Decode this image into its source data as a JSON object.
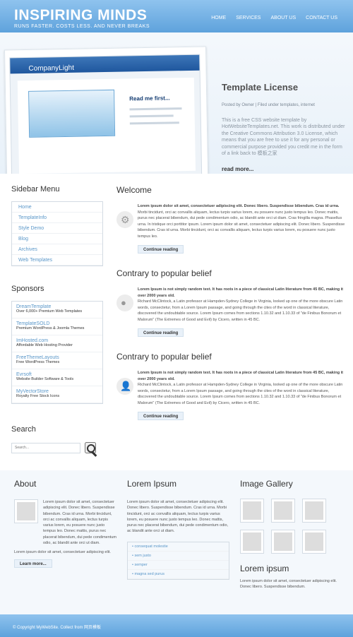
{
  "brand": {
    "title": "INSPIRING MINDS",
    "tagline": "RUNS FASTER. COSTS LESS. AND NEVER BREAKS"
  },
  "nav": [
    "HOME",
    "SERVICES",
    "ABOUT US",
    "CONTACT US"
  ],
  "hero": {
    "mock_logo": "CompanyLight",
    "read_more": "Read me first...",
    "title": "Template License",
    "meta": "Posted by Owner | Filed under templates, internet",
    "text": "This is a free CSS website template by HotWebsiteTemplates.net. This work is distributed under the Creative Commons Attribution 3.0 License, which means that you are free to use it for any personal or commercial purpose provided you credit me in the form of a link back to 模板之家",
    "more": "read more..."
  },
  "sidebar": {
    "title": "Sidebar Menu",
    "items": [
      "Home",
      "TemplateInfo",
      "Style Demo",
      "Blog",
      "Archives",
      "Web Templates"
    ]
  },
  "sponsors": {
    "title": "Sponsors",
    "items": [
      {
        "name": "DreamTemplate",
        "desc": "Over 6,000+ Premium Web Templates"
      },
      {
        "name": "TemplateSOLD",
        "desc": "Premium WordPress & Joomla Themes"
      },
      {
        "name": "ImHosted.com",
        "desc": "Affordable Web Hosting Provider"
      },
      {
        "name": "FreeThemeLayouts",
        "desc": "Free WordPress Themes"
      },
      {
        "name": "Evrsoft",
        "desc": "Website Builder Software & Tools"
      },
      {
        "name": "MyVectorStore",
        "desc": "Royalty Free Stock Icons"
      }
    ]
  },
  "search": {
    "title": "Search",
    "placeholder": "Search..."
  },
  "posts": [
    {
      "title": "Welcome",
      "lead": "Lorem ipsum dolor sit amet, consectetuer adipiscing elit. Donec libero. Suspendisse bibendum. Cras id urna.",
      "body": "Morbi tincidunt, orci ac convallis aliquam, lectus turpis varius lorem, eu posuere nunc justo tempus leo. Donec mattis, purus nec placerat bibendum, dui pede condimentum odio, ac blandit ante orci ut diam. Cras fringilla magna. Phasellus urna. In tristique orci porttitor ipsum. Lorem ipsum dolor sit amet, consectetuer adipiscing elit. Donec libero. Suspendisse bibendum. Cras id urna. Morbi tincidunt, orci ac convallis aliquam, lectus turpis varius lorem, eu posuere nunc justo tempus leo.",
      "button": "Continue reading"
    },
    {
      "title": "Contrary to popular belief",
      "lead": "Lorem Ipsum is not simply random text. It has roots in a piece of classical Latin literature from 45 BC, making it over 2000 years old.",
      "body": "Richard McClintock, a Latin professor at Hampden-Sydney College in Virginia, looked up one of the more obscure Latin words, consectetur, from a Lorem Ipsum passage, and going through the cites of the word in classical literature, discovered the undoubtable source. Lorem Ipsum comes from sections 1.10.32 and 1.10.33 of \"de Finibus Bonorum et Malorum\" (The Extremes of Good and Evil) by Cicero, written in 45 BC.",
      "button": "Continue reading"
    },
    {
      "title": "Contrary to popular belief",
      "lead": "Lorem Ipsum is not simply random text. It has roots in a piece of classical Latin literature from 45 BC, making it over 2000 years old.",
      "body": "Richard McClintock, a Latin professor at Hampden-Sydney College in Virginia, looked up one of the more obscure Latin words, consectetur, from a Lorem Ipsum passage, and going through the cites of the word in classical literature, discovered the undoubtable source. Lorem Ipsum comes from sections 1.10.32 and 1.10.33 of \"de Finibus Bonorum et Malorum\" (The Extremes of Good and Evil) by Cicero, written in 45 BC.",
      "button": "Continue reading"
    }
  ],
  "footer": {
    "about": {
      "title": "About",
      "text1": "Lorem ipsum dolor sit amet, consectetuer adipiscing elit. Donec libero. Suspendisse bibendum. Cras id urna. Morbi tincidunt, orci ac convallis aliquam, lectus turpis varius lorem, eu posuere nunc justo tempus leo. Donec mattis, purus nec placerat bibendum, dui pede condimentum odio, ac blandit ante orci ut diam.",
      "text2": "Lorem ipsum dolor sit amet, consectetuer adipiscing elit.",
      "button": "Learn more..."
    },
    "lorem": {
      "title": "Lorem Ipsum",
      "text": "Lorem ipsum dolor sit amet, consectetuer adipiscing elit. Donec libero. Suspendisse bibendum. Cras id urna. Morbi tincidunt, orci ac convallis aliquam, lectus turpis varius lorem, eu posuere nunc justo tempus leo. Donec mattis, purus nec placerat bibendum, dui pede condimentum odio, ac blandit ante orci ut diam.",
      "items": [
        "• consequat molestie",
        "• sem justo",
        "• semper",
        "• magna sed purus"
      ]
    },
    "gallery": {
      "title": "Image Gallery",
      "subtitle": "Lorem ipsum",
      "text": "Lorem ipsum dolor sit amet, consectetuer adipiscing elit. Donec libero. Suspendisse bibendum."
    }
  },
  "copyright": "© Copyright MyWebSite. Collect from 网页模板"
}
